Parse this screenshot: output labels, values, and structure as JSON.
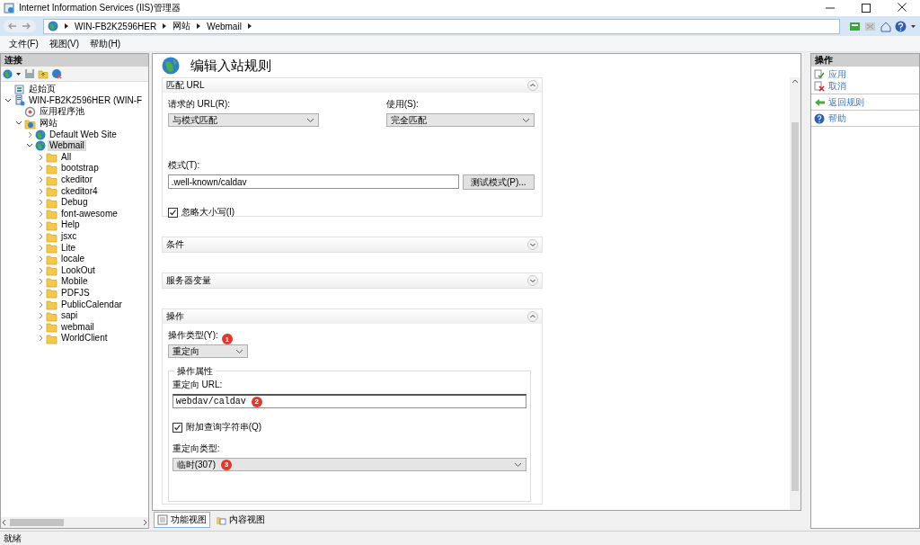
{
  "window": {
    "title": "Internet Information Services (IIS)管理器"
  },
  "address_bar": {
    "segments": [
      "WIN-FB2K2596HER",
      "网站",
      "Webmail"
    ]
  },
  "menu": [
    "文件(F)",
    "视图(V)",
    "帮助(H)"
  ],
  "connections": {
    "title": "连接",
    "tree": [
      {
        "label": "起始页",
        "kind": "start",
        "selected": false
      },
      {
        "label": "WIN-FB2K2596HER (WIN-F",
        "kind": "server",
        "expanded": true,
        "selected": false,
        "children": [
          {
            "label": "应用程序池",
            "kind": "pool",
            "selected": false
          },
          {
            "label": "网站",
            "kind": "sites",
            "expanded": true,
            "selected": false,
            "children": [
              {
                "label": "Default Web Site",
                "kind": "site",
                "expanded": false,
                "selected": false
              },
              {
                "label": "Webmail",
                "kind": "site",
                "expanded": true,
                "selected": true,
                "children": [
                  {
                    "label": "All",
                    "kind": "folder",
                    "expanded": false,
                    "selected": false
                  },
                  {
                    "label": "bootstrap",
                    "kind": "folder",
                    "expanded": false,
                    "selected": false
                  },
                  {
                    "label": "ckeditor",
                    "kind": "folder",
                    "expanded": false,
                    "selected": false
                  },
                  {
                    "label": "ckeditor4",
                    "kind": "folder",
                    "expanded": false,
                    "selected": false
                  },
                  {
                    "label": "Debug",
                    "kind": "folder",
                    "expanded": false,
                    "selected": false
                  },
                  {
                    "label": "font-awesome",
                    "kind": "folder",
                    "expanded": false,
                    "selected": false
                  },
                  {
                    "label": "Help",
                    "kind": "folder",
                    "expanded": false,
                    "selected": false
                  },
                  {
                    "label": "jsxc",
                    "kind": "folder",
                    "expanded": false,
                    "selected": false
                  },
                  {
                    "label": "Lite",
                    "kind": "folder",
                    "expanded": false,
                    "selected": false
                  },
                  {
                    "label": "locale",
                    "kind": "folder",
                    "expanded": false,
                    "selected": false
                  },
                  {
                    "label": "LookOut",
                    "kind": "folder",
                    "expanded": false,
                    "selected": false
                  },
                  {
                    "label": "Mobile",
                    "kind": "folder",
                    "expanded": false,
                    "selected": false
                  },
                  {
                    "label": "PDFJS",
                    "kind": "folder",
                    "expanded": false,
                    "selected": false
                  },
                  {
                    "label": "PublicCalendar",
                    "kind": "folder",
                    "expanded": false,
                    "selected": false
                  },
                  {
                    "label": "sapi",
                    "kind": "folder",
                    "expanded": false,
                    "selected": false
                  },
                  {
                    "label": "webmail",
                    "kind": "folder",
                    "expanded": false,
                    "selected": false
                  },
                  {
                    "label": "WorldClient",
                    "kind": "folder",
                    "expanded": false,
                    "selected": false
                  }
                ]
              }
            ]
          }
        ]
      }
    ]
  },
  "editor": {
    "title": "编辑入站规则",
    "sections": [
      {
        "kind": "match_url",
        "title": "匹配 URL",
        "expanded": true,
        "requested_url": {
          "label": "请求的 URL(R):",
          "value": "与模式匹配"
        },
        "using": {
          "label": "使用(S):",
          "value": "完全匹配"
        },
        "pattern": {
          "label": "模式(T):",
          "value": ".well-known/caldav"
        },
        "test_button": "测试模式(P)...",
        "ignore_case": {
          "label": "忽略大小写(I)",
          "checked": true
        }
      },
      {
        "kind": "conditions",
        "title": "条件",
        "expanded": false
      },
      {
        "kind": "server_variables",
        "title": "服务器变量",
        "expanded": false
      },
      {
        "kind": "action",
        "title": "操作",
        "expanded": true,
        "action_type": {
          "label": "操作类型(Y):",
          "value": "重定向",
          "badge": "1"
        },
        "properties": {
          "title": "操作属性",
          "redirect_url": {
            "label": "重定向 URL:",
            "value": "webdav/caldav",
            "badge": "2"
          },
          "append_query": {
            "label": "附加查询字符串(Q)",
            "checked": true
          },
          "redirect_type": {
            "label": "重定向类型:",
            "value": "临时(307)",
            "badge": "3"
          }
        }
      }
    ]
  },
  "view_tabs": [
    {
      "label": "功能视图",
      "selected": true
    },
    {
      "label": "内容视图",
      "selected": false
    }
  ],
  "actions": {
    "title": "操作",
    "groups": [
      [
        {
          "label": "应用",
          "kind": "apply"
        },
        {
          "label": "取消",
          "kind": "cancel"
        }
      ],
      [
        {
          "label": "返回规则",
          "kind": "back"
        }
      ],
      [
        {
          "label": "帮助",
          "kind": "help"
        }
      ]
    ]
  },
  "status_bar": {
    "text": "就绪"
  }
}
